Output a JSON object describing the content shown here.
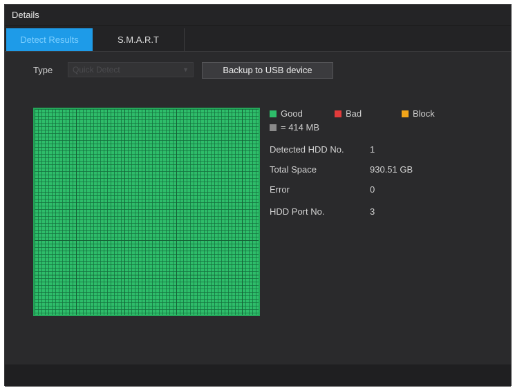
{
  "window": {
    "title": "Details"
  },
  "tabs": [
    {
      "label": "Detect Results",
      "active": true
    },
    {
      "label": "S.M.A.R.T",
      "active": false
    }
  ],
  "type_field": {
    "label": "Type",
    "selected": "Quick Detect"
  },
  "backup_button": {
    "label": "Backup to USB device"
  },
  "legend": {
    "good": {
      "label": "Good",
      "color": "#2ebd6a"
    },
    "bad": {
      "label": "Bad",
      "color": "#e23b3b"
    },
    "block": {
      "label": "Block",
      "color": "#f2a51a"
    },
    "unit": {
      "label": "= 414 MB",
      "color": "#8a8a8a"
    }
  },
  "info": [
    {
      "label": "Detected HDD No.",
      "value": "1"
    },
    {
      "label": "Total Space",
      "value": "930.51 GB"
    },
    {
      "label": "Error",
      "value": "0"
    },
    {
      "label": "HDD Port No.",
      "value": "3"
    }
  ],
  "colors": {
    "accent": "#1e9be8",
    "background": "#2b2b2d",
    "good_block": "#2ebd6a"
  }
}
